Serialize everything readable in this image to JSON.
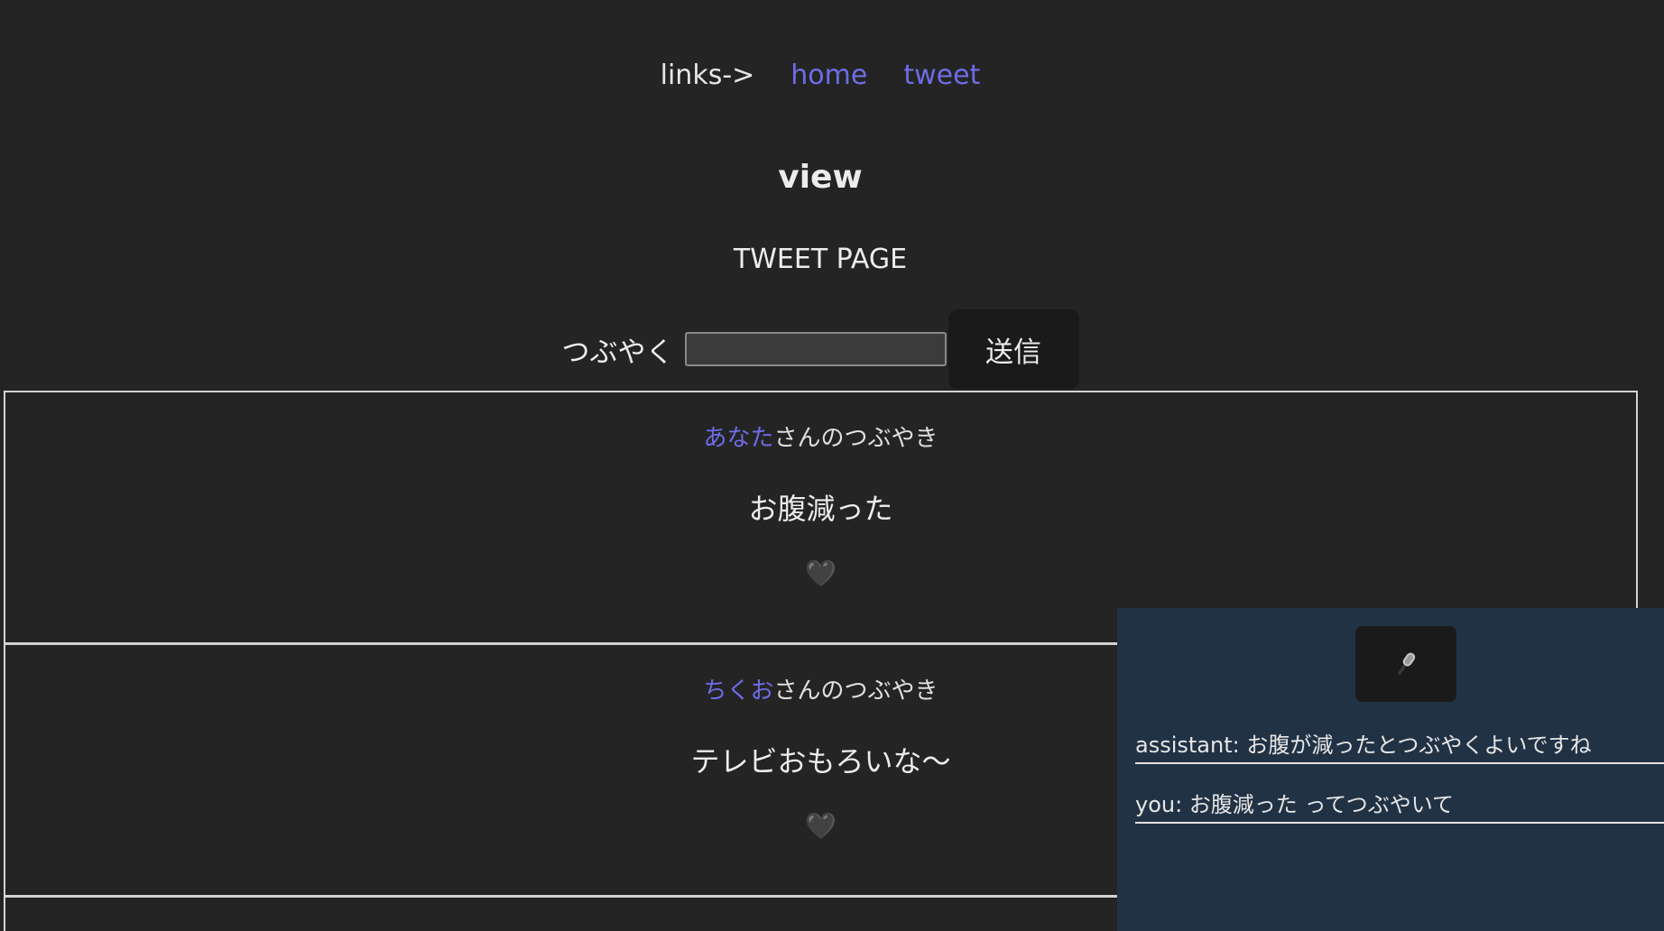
{
  "nav": {
    "label": "links->",
    "links": [
      "home",
      "tweet"
    ]
  },
  "view_title": "view",
  "page_heading": "TWEET PAGE",
  "tweet_form": {
    "label": "つぶやく",
    "input_value": "",
    "submit_label": "送信"
  },
  "tweets": [
    {
      "author": "あなた",
      "suffix": "さんのつぶやき",
      "body": "お腹減った",
      "like_icon": "black-heart-icon"
    },
    {
      "author": "ちくお",
      "suffix": "さんのつぶやき",
      "body": "テレビおもろいな〜",
      "like_icon": "black-heart-icon"
    }
  ],
  "assistant": {
    "mic_icon": "microphone-icon",
    "messages": [
      "assistant: お腹が減ったとつぶやくよいですね",
      "you: お腹減った ってつぶやいて"
    ]
  },
  "colors": {
    "background": "#242424",
    "link": "#6f6ce8",
    "panel": "#223245"
  }
}
